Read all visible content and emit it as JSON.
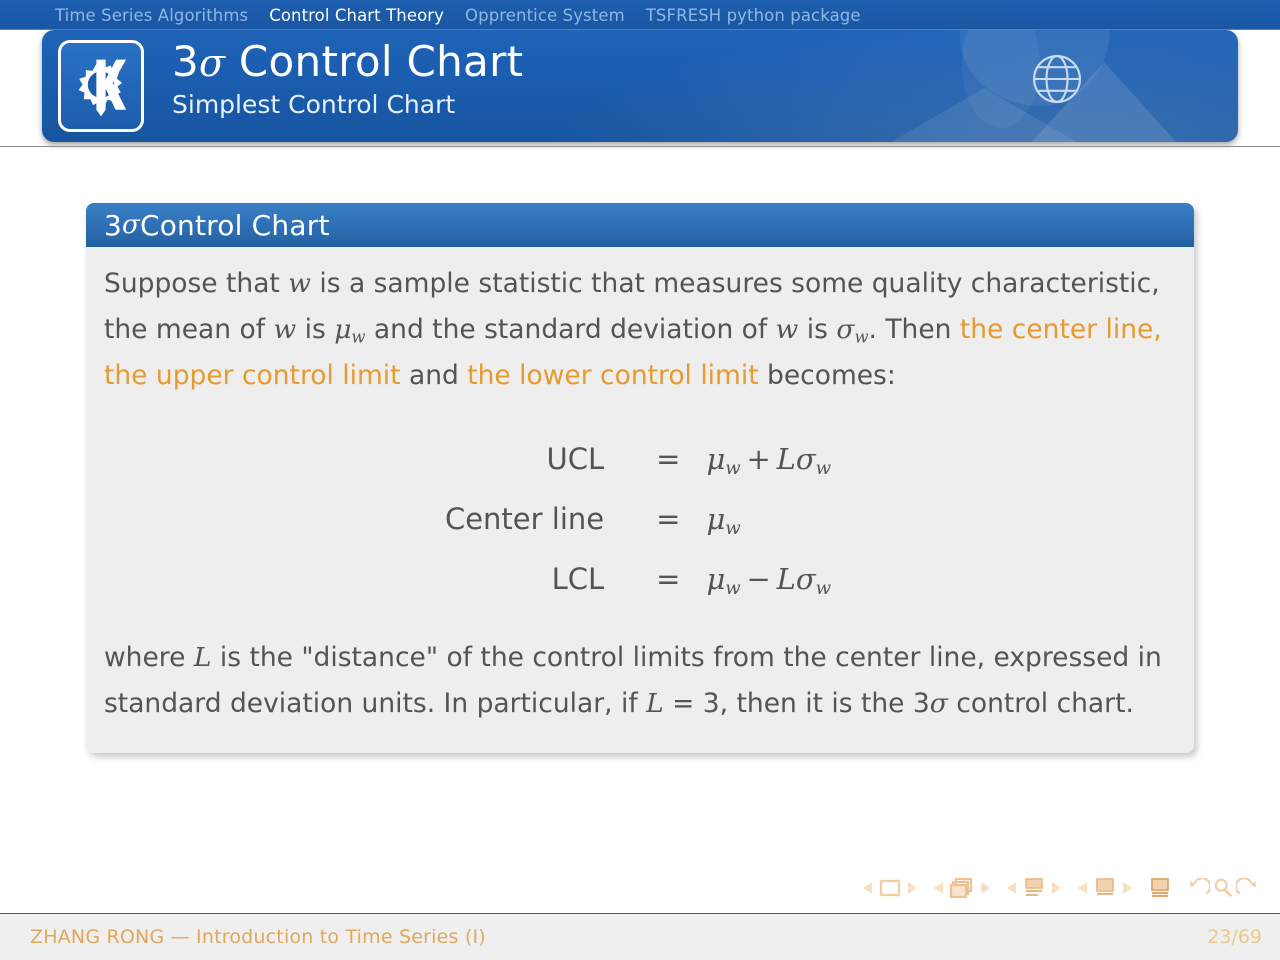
{
  "nav": {
    "items": [
      {
        "label": "Time Series Algorithms",
        "active": false
      },
      {
        "label": "Control Chart Theory",
        "active": true
      },
      {
        "label": "Opprentice System",
        "active": false
      },
      {
        "label": "TSFRESH python package",
        "active": false
      }
    ]
  },
  "header": {
    "title_num": "3",
    "title_sigma": "σ",
    "title_rest": " Control Chart",
    "subtitle": "Simplest Control Chart",
    "logo_name": "kde-gear-k-logo",
    "globe_name": "globe-icon"
  },
  "block": {
    "title_num": "3",
    "title_sigma": "σ",
    "title_rest": " Control Chart",
    "paragraph1": {
      "seg1": "Suppose that ",
      "var_w1": "w",
      "seg2": " is a sample statistic that measures some quality characteristic, the mean of ",
      "var_w2": "w",
      "seg3": " is ",
      "mu": "μ",
      "mu_sub": "w",
      "seg4": " and the standard deviation of ",
      "var_w3": "w",
      "seg5": " is ",
      "sigma": "σ",
      "sigma_sub": "w",
      "seg6": ". Then ",
      "hl1": "the center line, the upper control limit",
      "seg7": " and ",
      "hl2": "the lower control limit",
      "seg8": " becomes:"
    },
    "equations": [
      {
        "lhs": "UCL",
        "eq": "=",
        "rhs_mu": "μ",
        "rhs_mu_sub": "w",
        "rhs_op": "+",
        "rhs_L": "L",
        "rhs_sigma": "σ",
        "rhs_sigma_sub": "w"
      },
      {
        "lhs": "Center line",
        "eq": "=",
        "rhs_mu": "μ",
        "rhs_mu_sub": "w",
        "rhs_op": "",
        "rhs_L": "",
        "rhs_sigma": "",
        "rhs_sigma_sub": ""
      },
      {
        "lhs": "LCL",
        "eq": "=",
        "rhs_mu": "μ",
        "rhs_mu_sub": "w",
        "rhs_op": "−",
        "rhs_L": "L",
        "rhs_sigma": "σ",
        "rhs_sigma_sub": "w"
      }
    ],
    "paragraph2": {
      "seg1": "where ",
      "var_L1": "L",
      "seg2": " is the \"distance\" of the control limits from the center line, expressed in standard deviation units. In particular, if ",
      "var_L2": "L",
      "seg3": " = 3",
      "seg4": ", then it is the 3",
      "sigma": "σ",
      "seg5": " control chart."
    }
  },
  "footer": {
    "author_title": "ZHANG RONG — Introduction to Time Series (I)",
    "page": "23/69",
    "nav_symbols": [
      "prev-slide-arrow",
      "slide-icon",
      "next-slide-arrow",
      "prev-frame-arrow",
      "frames-icon",
      "next-frame-arrow",
      "prev-subsection-arrow",
      "subsection-icon",
      "next-subsection-arrow",
      "prev-section-arrow",
      "section-icon",
      "next-section-arrow",
      "doc-icon",
      "back-icon",
      "search-icon",
      "forward-icon"
    ]
  },
  "colors": {
    "header_blue": "#1a5cae",
    "block_header_blue": "#2e6fb4",
    "block_body_gray": "#eeeeee",
    "highlight_orange": "#e79a2f",
    "footer_orange": "#e0a85a",
    "body_text": "#545454"
  }
}
